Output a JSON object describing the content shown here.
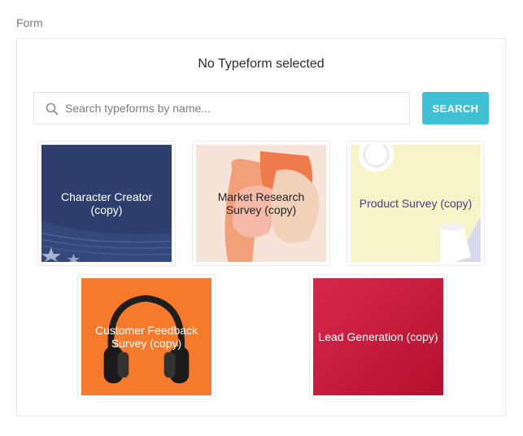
{
  "form_label": "Form",
  "panel": {
    "title": "No Typeform selected",
    "search": {
      "placeholder": "Search typeforms by name...",
      "value": "",
      "icon": "search-icon"
    },
    "search_button_label": "SEARCH"
  },
  "typeforms": [
    {
      "title": "Character Creator (copy)",
      "background": "#2e3f6e",
      "label_color": "#ffffff"
    },
    {
      "title": "Market Research Survey (copy)",
      "background": "#f6e4d8",
      "label_color": "#222222"
    },
    {
      "title": "Product Survey (copy)",
      "background": "#f6f4c8",
      "label_color": "#4c3b79"
    },
    {
      "title": "Customer Feedback Survey (copy)",
      "background": "#f57a2c",
      "label_color": "#ffffff"
    },
    {
      "title": "Lead Generation (copy)",
      "background": "#c9163a",
      "label_color": "#ffffff"
    }
  ]
}
